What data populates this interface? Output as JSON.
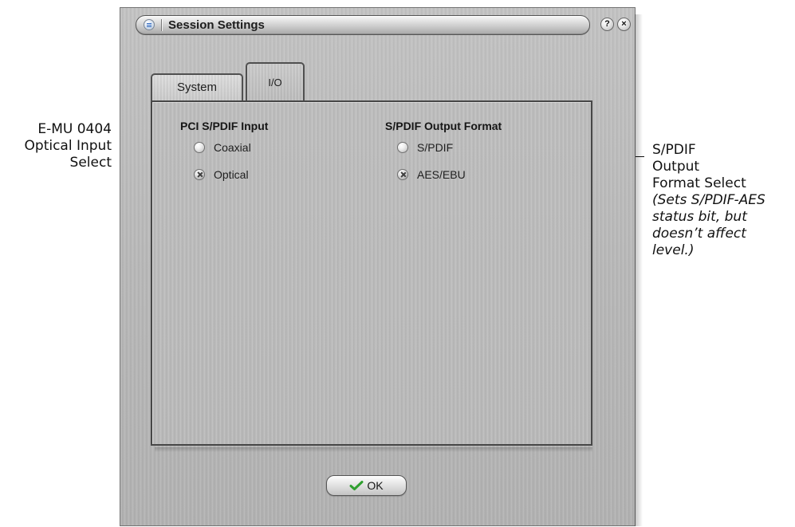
{
  "window": {
    "title": "Session Settings",
    "help_label": "?",
    "close_label": "×"
  },
  "tabs": [
    {
      "label": "System",
      "selected": false
    },
    {
      "label": "I/O",
      "selected": true
    }
  ],
  "main": {
    "left_group": {
      "title": "PCI S/PDIF Input",
      "options": [
        {
          "label": "Coaxial",
          "selected": false
        },
        {
          "label": "Optical",
          "selected": true
        }
      ]
    },
    "right_group": {
      "title": "S/PDIF Output Format",
      "options": [
        {
          "label": "S/PDIF",
          "selected": false
        },
        {
          "label": "AES/EBU",
          "selected": true
        }
      ]
    }
  },
  "ok_button": {
    "label": "OK"
  },
  "annotations": {
    "left_lines": [
      "E-MU 0404",
      "Optical Input",
      "Select"
    ],
    "right_lines": [
      "S/PDIF",
      "Output",
      "Format Select",
      "(Sets S/PDIF-AES",
      "status bit, but",
      "doesn’t affect",
      "level.)"
    ]
  },
  "icons": {
    "window_menu": "window-menu-icon",
    "help": "help-icon",
    "close": "close-icon",
    "ok": "check-icon",
    "radio_unselected": "radio-unselected-icon",
    "radio_selected": "radio-selected-icon"
  },
  "colors": {
    "ok_check": "#2f9f2f",
    "menu_icon_blue": "#2f68bf"
  }
}
